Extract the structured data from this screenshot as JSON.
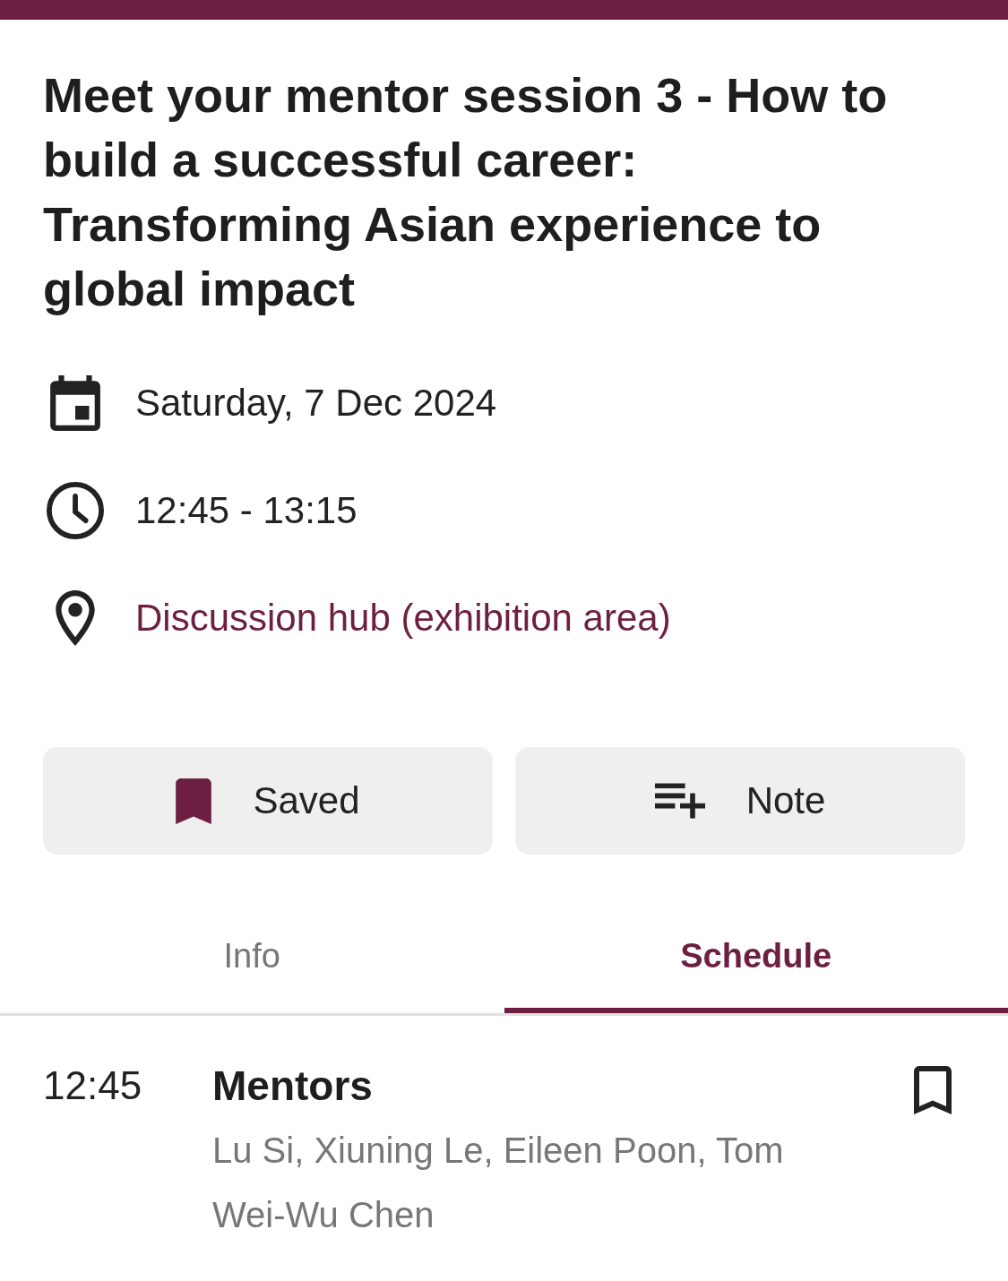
{
  "event": {
    "title": "Meet your mentor session 3 - How to build a successful career: Transforming Asian experience to global impact"
  },
  "details": [
    {
      "kind": "date",
      "text": "Saturday, 7 Dec 2024"
    },
    {
      "kind": "time",
      "text": "12:45 - 13:15"
    },
    {
      "kind": "location",
      "text": "Discussion hub (exhibition area)"
    }
  ],
  "actions": [
    {
      "kind": "save",
      "label": "Saved",
      "saved": true
    },
    {
      "kind": "note",
      "label": "Note"
    }
  ],
  "tabs": [
    {
      "label": "Info",
      "selected": false
    },
    {
      "label": "Schedule",
      "selected": true
    }
  ],
  "schedule": [
    {
      "time": "12:45",
      "title": "Mentors",
      "people": "Lu Si, Xiuning Le, Eileen Poon, Tom Wei-Wu Chen",
      "saved": false
    }
  ]
}
